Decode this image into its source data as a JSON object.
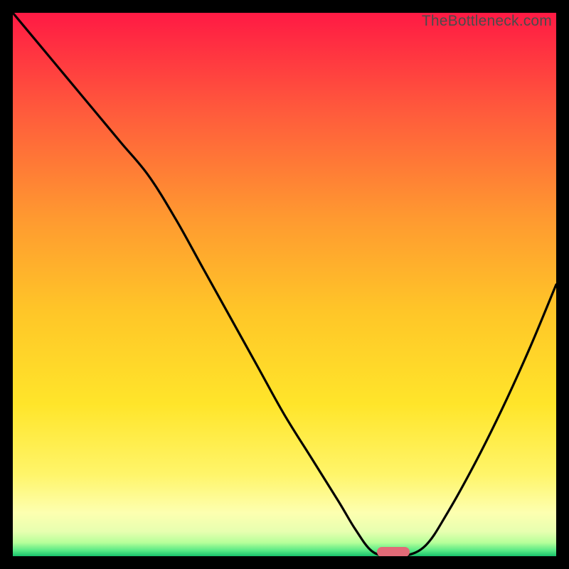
{
  "watermark": "TheBottleneck.com",
  "chart_data": {
    "type": "line",
    "title": "",
    "xlabel": "",
    "ylabel": "",
    "x_range": [
      0,
      100
    ],
    "y_range": [
      0,
      100
    ],
    "grid": false,
    "legend": false,
    "series": [
      {
        "name": "curve",
        "color": "#000000",
        "x": [
          0,
          5,
          10,
          15,
          20,
          25,
          30,
          35,
          40,
          45,
          50,
          55,
          60,
          63,
          66,
          69,
          72,
          76,
          80,
          85,
          90,
          95,
          100
        ],
        "y": [
          100,
          94,
          88,
          82,
          76,
          70,
          62,
          53,
          44,
          35,
          26,
          18,
          10,
          5,
          1,
          0,
          0,
          2,
          8,
          17,
          27,
          38,
          50
        ]
      }
    ],
    "annotations": [
      {
        "type": "pill-marker",
        "color": "#e26a77",
        "x_start": 67,
        "x_end": 73,
        "y": 0
      }
    ],
    "background_gradient": {
      "description": "vertical red→orange→yellow→light-yellow with thin green band at bottom",
      "stops": [
        {
          "offset": 0,
          "color": "#ff1a44"
        },
        {
          "offset": 0.18,
          "color": "#ff5a3c"
        },
        {
          "offset": 0.38,
          "color": "#ff9a30"
        },
        {
          "offset": 0.55,
          "color": "#ffc628"
        },
        {
          "offset": 0.72,
          "color": "#ffe52a"
        },
        {
          "offset": 0.85,
          "color": "#fff56a"
        },
        {
          "offset": 0.92,
          "color": "#fdffb0"
        },
        {
          "offset": 0.955,
          "color": "#e7ffb0"
        },
        {
          "offset": 0.975,
          "color": "#b6ff9a"
        },
        {
          "offset": 0.99,
          "color": "#55e884"
        },
        {
          "offset": 1.0,
          "color": "#18c26b"
        }
      ]
    }
  }
}
